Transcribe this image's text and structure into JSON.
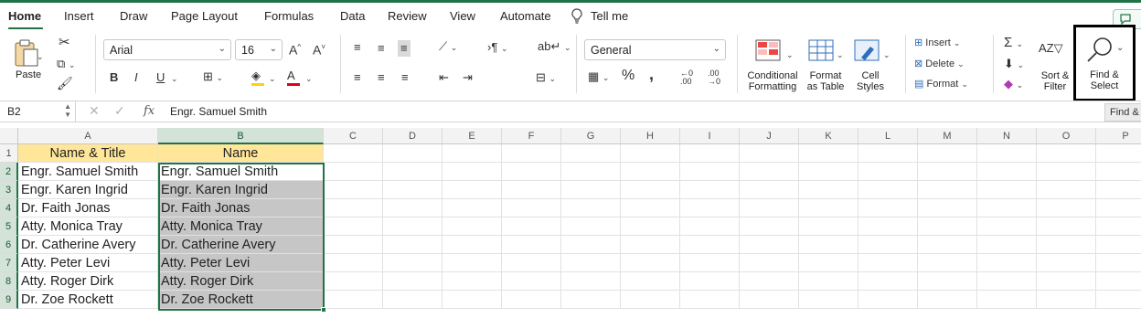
{
  "tabs": [
    "Home",
    "Insert",
    "Draw",
    "Page Layout",
    "Formulas",
    "Data",
    "Review",
    "View",
    "Automate"
  ],
  "tell_me": "Tell me",
  "ribbon": {
    "paste": "Paste",
    "font_name": "Arial",
    "font_size": "16",
    "number_format": "General",
    "bold": "B",
    "italic": "I",
    "underline": "U",
    "font_grow": "A^",
    "font_shrink": "A˅",
    "percent": "%",
    "comma": ",",
    "cond_format": [
      "Conditional",
      "Formatting"
    ],
    "format_table": [
      "Format",
      "as Table"
    ],
    "cell_styles": [
      "Cell",
      "Styles"
    ],
    "insert": "Insert",
    "delete": "Delete",
    "format": "Format",
    "sort_filter": [
      "Sort &",
      "Filter"
    ],
    "find_select": [
      "Find &",
      "Select"
    ],
    "accent_color": "#217346"
  },
  "formula_bar": {
    "name_box": "B2",
    "formula": "Engr. Samuel Smith",
    "fx": "fx"
  },
  "tooltip": "Find &",
  "columns": [
    "A",
    "B",
    "C",
    "D",
    "E",
    "F",
    "G",
    "H",
    "I",
    "J",
    "K",
    "L",
    "M",
    "N",
    "O",
    "P"
  ],
  "rows": [
    "1",
    "2",
    "3",
    "4",
    "5",
    "6",
    "7",
    "8",
    "9"
  ],
  "sheet": {
    "col_a": [
      "Name & Title",
      "Engr. Samuel Smith",
      "Engr. Karen Ingrid",
      "Dr. Faith Jonas",
      "Atty. Monica Tray",
      "Dr. Catherine Avery",
      "Atty. Peter Levi",
      "Atty. Roger Dirk",
      "Dr. Zoe Rockett"
    ],
    "col_b": [
      "Name",
      "Engr. Samuel Smith",
      "Engr. Karen Ingrid",
      "Dr. Faith Jonas",
      "Atty. Monica Tray",
      "Dr. Catherine Avery",
      "Atty. Peter Levi",
      "Atty. Roger Dirk",
      "Dr. Zoe Rockett"
    ]
  }
}
